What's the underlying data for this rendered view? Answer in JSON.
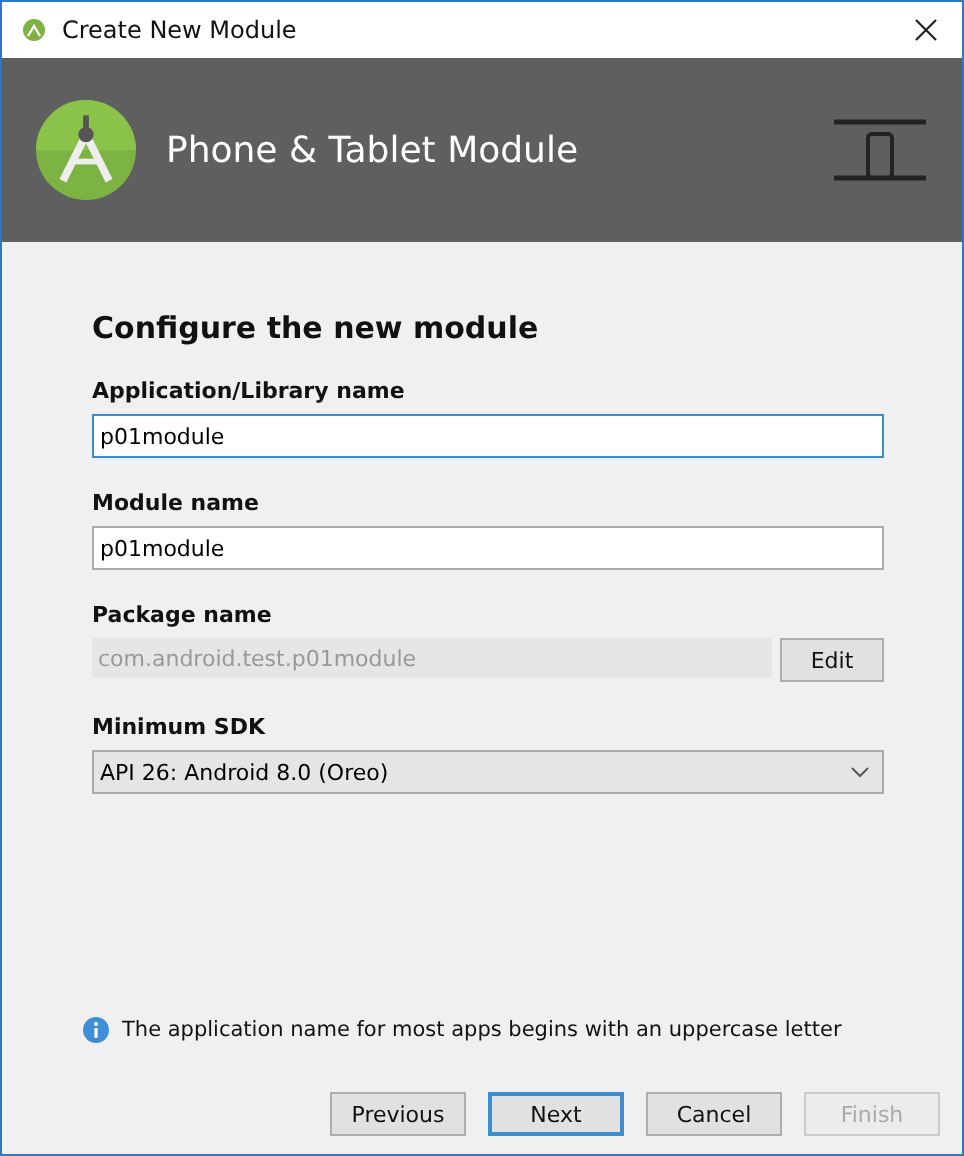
{
  "window": {
    "title": "Create New Module"
  },
  "header": {
    "title": "Phone & Tablet Module"
  },
  "form": {
    "heading": "Configure the new module",
    "fields": [
      {
        "kind": "text",
        "label": "Application/Library name",
        "value": "p01module",
        "focused": true
      },
      {
        "kind": "text",
        "label": "Module name",
        "value": "p01module",
        "focused": false
      },
      {
        "kind": "readonly",
        "label": "Package name",
        "value": "com.android.test.p01module",
        "button": "Edit"
      },
      {
        "kind": "dropdown",
        "label": "Minimum SDK",
        "value": "API 26: Android 8.0 (Oreo)"
      }
    ]
  },
  "info": "The application name for most apps begins with an uppercase letter",
  "buttons": [
    {
      "label": "Previous",
      "default": false,
      "disabled": false
    },
    {
      "label": "Next",
      "default": true,
      "disabled": false
    },
    {
      "label": "Cancel",
      "default": false,
      "disabled": false
    },
    {
      "label": "Finish",
      "default": false,
      "disabled": true
    }
  ]
}
